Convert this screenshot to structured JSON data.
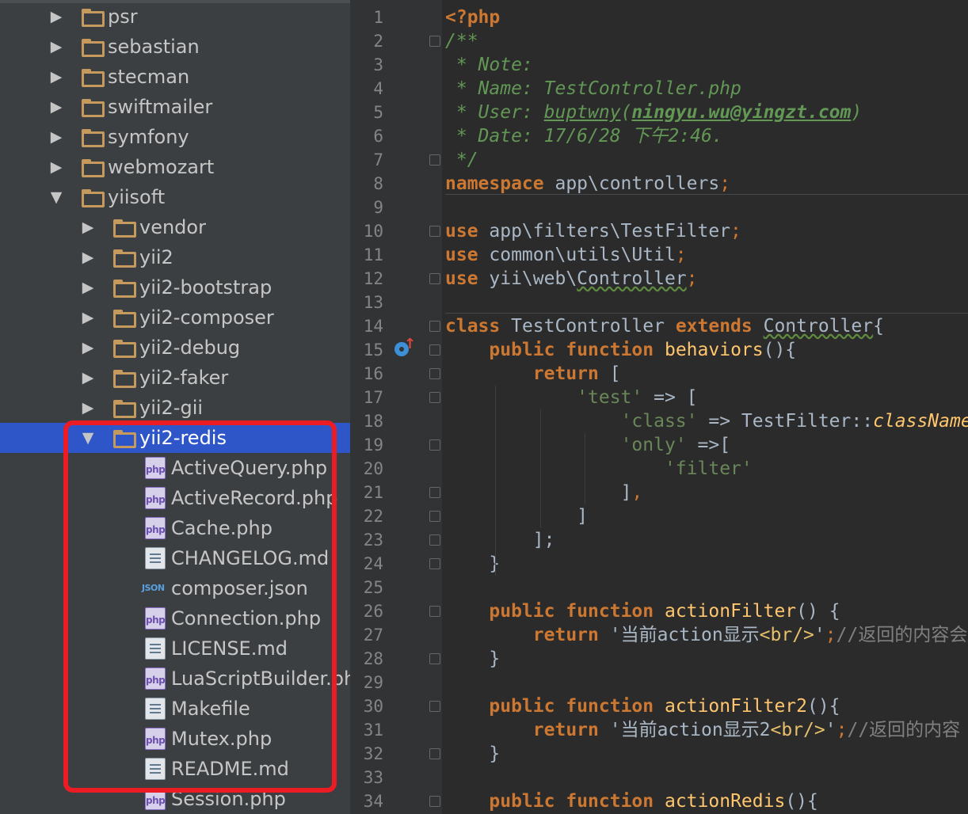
{
  "project_tree": {
    "rows": [
      {
        "label": "psr",
        "kind": "folder",
        "level": 0,
        "expanded": false
      },
      {
        "label": "sebastian",
        "kind": "folder",
        "level": 0,
        "expanded": false
      },
      {
        "label": "stecman",
        "kind": "folder",
        "level": 0,
        "expanded": false
      },
      {
        "label": "swiftmailer",
        "kind": "folder",
        "level": 0,
        "expanded": false
      },
      {
        "label": "symfony",
        "kind": "folder",
        "level": 0,
        "expanded": false
      },
      {
        "label": "webmozart",
        "kind": "folder",
        "level": 0,
        "expanded": false
      },
      {
        "label": "yiisoft",
        "kind": "folder",
        "level": 0,
        "expanded": true
      },
      {
        "label": "vendor",
        "kind": "folder",
        "level": 1,
        "expanded": false
      },
      {
        "label": "yii2",
        "kind": "folder",
        "level": 1,
        "expanded": false
      },
      {
        "label": "yii2-bootstrap",
        "kind": "folder",
        "level": 1,
        "expanded": false
      },
      {
        "label": "yii2-composer",
        "kind": "folder",
        "level": 1,
        "expanded": false
      },
      {
        "label": "yii2-debug",
        "kind": "folder",
        "level": 1,
        "expanded": false
      },
      {
        "label": "yii2-faker",
        "kind": "folder",
        "level": 1,
        "expanded": false
      },
      {
        "label": "yii2-gii",
        "kind": "folder",
        "level": 1,
        "expanded": false
      },
      {
        "label": "yii2-redis",
        "kind": "folder",
        "level": 1,
        "expanded": true,
        "selected": true
      },
      {
        "label": "ActiveQuery.php",
        "kind": "php",
        "level": 2
      },
      {
        "label": "ActiveRecord.php",
        "kind": "php",
        "level": 2
      },
      {
        "label": "Cache.php",
        "kind": "php",
        "level": 2
      },
      {
        "label": "CHANGELOG.md",
        "kind": "text",
        "level": 2
      },
      {
        "label": "composer.json",
        "kind": "json",
        "level": 2
      },
      {
        "label": "Connection.php",
        "kind": "php",
        "level": 2
      },
      {
        "label": "LICENSE.md",
        "kind": "text",
        "level": 2
      },
      {
        "label": "LuaScriptBuilder.php",
        "kind": "php",
        "level": 2
      },
      {
        "label": "Makefile",
        "kind": "text",
        "level": 2
      },
      {
        "label": "Mutex.php",
        "kind": "php",
        "level": 2
      },
      {
        "label": "README.md",
        "kind": "text",
        "level": 2
      },
      {
        "label": "Session.php",
        "kind": "php",
        "level": 2
      }
    ],
    "icon_labels": {
      "php": "php",
      "json": "JSON"
    },
    "highlight_color": "#ec1c24",
    "selection_color": "#2e56c8"
  },
  "editor": {
    "lines": [
      [
        [
          "<?php",
          "kw"
        ]
      ],
      [
        [
          "/**",
          "doc"
        ]
      ],
      [
        [
          " * Note:",
          "doc"
        ]
      ],
      [
        [
          " * Name: TestController.php",
          "doc"
        ]
      ],
      [
        [
          " * User: ",
          "doc"
        ],
        [
          "buptwny",
          "doc-u"
        ],
        [
          "(",
          "doc"
        ],
        [
          "ningyu.wu@yingzt.com",
          "doc-ub"
        ],
        [
          ")",
          "doc"
        ]
      ],
      [
        [
          " * Date: 17/6/28 下午2:46.",
          "doc"
        ]
      ],
      [
        [
          " */",
          "doc"
        ]
      ],
      [
        [
          "namespace",
          "kw"
        ],
        [
          " app\\controllers",
          ""
        ],
        [
          ";",
          "punc"
        ]
      ],
      [],
      [
        [
          "use",
          "kw"
        ],
        [
          " app\\filters\\TestFilter",
          ""
        ],
        [
          ";",
          "punc"
        ]
      ],
      [
        [
          "use",
          "kw"
        ],
        [
          " common\\utils\\Util",
          ""
        ],
        [
          ";",
          "punc"
        ]
      ],
      [
        [
          "use",
          "kw"
        ],
        [
          " yii\\web\\",
          ""
        ],
        [
          "Controller",
          "wavy"
        ],
        [
          ";",
          "punc"
        ]
      ],
      [],
      [
        [
          "class",
          "kw"
        ],
        [
          " TestController ",
          ""
        ],
        [
          "extends",
          "kw"
        ],
        [
          " ",
          ""
        ],
        [
          "Controller",
          "wavy"
        ],
        [
          "{",
          ""
        ]
      ],
      [
        [
          "    ",
          ""
        ],
        [
          "public",
          "kw"
        ],
        [
          " ",
          ""
        ],
        [
          "function",
          "kw"
        ],
        [
          " ",
          ""
        ],
        [
          "behaviors",
          "fn"
        ],
        [
          "(){",
          ""
        ]
      ],
      [
        [
          "        ",
          ""
        ],
        [
          "return",
          "kw"
        ],
        [
          " [",
          ""
        ]
      ],
      [
        [
          "            ",
          ""
        ],
        [
          "'test'",
          "str"
        ],
        [
          " => [",
          ""
        ]
      ],
      [
        [
          "                ",
          ""
        ],
        [
          "'class'",
          "str"
        ],
        [
          " => TestFilter::",
          ""
        ],
        [
          "className",
          "static"
        ]
      ],
      [
        [
          "                ",
          ""
        ],
        [
          "'only'",
          "str"
        ],
        [
          " =>[",
          ""
        ]
      ],
      [
        [
          "                    ",
          ""
        ],
        [
          "'filter'",
          "str"
        ]
      ],
      [
        [
          "                ",
          ""
        ],
        [
          "]",
          ""
        ],
        [
          ",",
          "punc"
        ]
      ],
      [
        [
          "            ]",
          ""
        ]
      ],
      [
        [
          "        ];",
          ""
        ]
      ],
      [
        [
          "    }",
          ""
        ]
      ],
      [],
      [
        [
          "    ",
          ""
        ],
        [
          "public",
          "kw"
        ],
        [
          " ",
          ""
        ],
        [
          "function",
          "kw"
        ],
        [
          " ",
          ""
        ],
        [
          "actionFilter",
          "fn"
        ],
        [
          "() {",
          ""
        ]
      ],
      [
        [
          "        ",
          ""
        ],
        [
          "return",
          "kw"
        ],
        [
          " '",
          ""
        ],
        [
          "当前action显示",
          ""
        ],
        [
          "<br/>",
          "html"
        ],
        [
          "'",
          ""
        ],
        [
          ";",
          "punc"
        ],
        [
          "//返回的内容会",
          ""
        ]
      ],
      [
        [
          "    }",
          ""
        ]
      ],
      [],
      [
        [
          "    ",
          ""
        ],
        [
          "public",
          "kw"
        ],
        [
          " ",
          ""
        ],
        [
          "function",
          "kw"
        ],
        [
          " ",
          ""
        ],
        [
          "actionFilter2",
          "fn"
        ],
        [
          "(){",
          ""
        ]
      ],
      [
        [
          "        ",
          ""
        ],
        [
          "return",
          "kw"
        ],
        [
          " '",
          ""
        ],
        [
          "当前action显示2",
          ""
        ],
        [
          "<br/>",
          "html"
        ],
        [
          "'",
          ""
        ],
        [
          ";",
          "punc"
        ],
        [
          "//返回的内容",
          ""
        ]
      ],
      [
        [
          "    }",
          ""
        ]
      ],
      [],
      [
        [
          "    ",
          ""
        ],
        [
          "public",
          "kw"
        ],
        [
          " ",
          ""
        ],
        [
          "function",
          "kw"
        ],
        [
          " ",
          ""
        ],
        [
          "actionRedis",
          "fn"
        ],
        [
          "(){",
          ""
        ]
      ]
    ]
  }
}
